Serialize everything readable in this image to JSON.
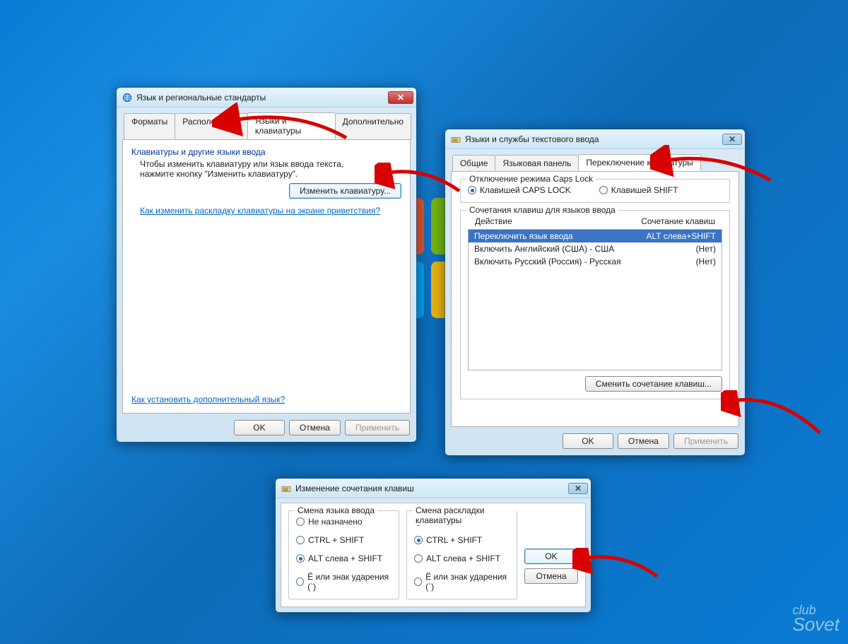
{
  "watermark": {
    "line1": "club",
    "line2": "Sovet"
  },
  "dialog1": {
    "title": "Язык и региональные стандарты",
    "tabs": [
      "Форматы",
      "Расположение",
      "Языки и клавиатуры",
      "Дополнительно"
    ],
    "active_tab": 2,
    "group_heading": "Клавиатуры и другие языки ввода",
    "description": "Чтобы изменить клавиатуру или язык ввода текста, нажмите кнопку \"Изменить клавиатуру\".",
    "change_button": "Изменить клавиатуру...",
    "link1": "Как изменить раскладку клавиатуры на экране приветствия?",
    "link2": "Как установить дополнительный язык?",
    "ok": "OK",
    "cancel": "Отмена",
    "apply": "Применить"
  },
  "dialog2": {
    "title": "Языки и службы текстового ввода",
    "tabs": [
      "Общие",
      "Языковая панель",
      "Переключение клавиатуры"
    ],
    "active_tab": 2,
    "capslock_group": "Отключение режима Caps Lock",
    "radio_caps": "Клавишей CAPS LOCK",
    "radio_shift": "Клавишей SHIFT",
    "hotkeys_group": "Сочетания клавиш для языков ввода",
    "col_action": "Действие",
    "col_combo": "Сочетание клавиш",
    "rows": [
      {
        "action": "Переключить язык ввода",
        "combo": "ALT слева+SHIFT",
        "selected": true
      },
      {
        "action": "Включить Английский (США) - США",
        "combo": "(Нет)",
        "selected": false
      },
      {
        "action": "Включить Русский (Россия) - Русская",
        "combo": "(Нет)",
        "selected": false
      }
    ],
    "change_button": "Сменить сочетание клавиш...",
    "ok": "OK",
    "cancel": "Отмена",
    "apply": "Применить"
  },
  "dialog3": {
    "title": "Изменение сочетания клавиш",
    "left_group": "Смена языка ввода",
    "right_group": "Смена раскладки клавиатуры",
    "options": {
      "none": "Не назначено",
      "ctrl_shift": "CTRL + SHIFT",
      "alt_shift": "ALT слева + SHIFT",
      "grave": "Ё или знак ударения (`)"
    },
    "left_selected": "alt_shift",
    "right_selected": "ctrl_shift",
    "ok": "OK",
    "cancel": "Отмена"
  }
}
